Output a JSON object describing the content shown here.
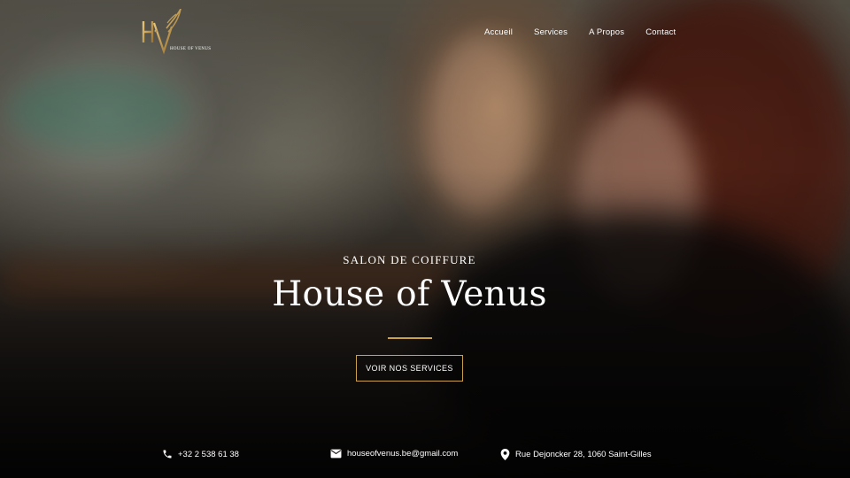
{
  "brand": {
    "logo_monogram": "HV",
    "logo_text": "HOUSE OF VENUS",
    "accent_color": "#c9a24b"
  },
  "nav": {
    "items": [
      {
        "label": "Accueil"
      },
      {
        "label": "Services"
      },
      {
        "label": "A Propos"
      },
      {
        "label": "Contact"
      }
    ]
  },
  "hero": {
    "kicker": "SALON DE COIFFURE",
    "title": "House of Venus",
    "cta_label": "VOIR NOS SERVICES",
    "background_image": "salon-clients-smiling"
  },
  "contact": {
    "phone": {
      "icon": "phone-icon",
      "text": "+32 2 538 61 38"
    },
    "email": {
      "icon": "mail-icon",
      "text": "houseofvenus.be@gmail.com"
    },
    "address": {
      "icon": "location-pin-icon",
      "text": "Rue Dejoncker 28, 1060 Saint-Gilles"
    }
  }
}
